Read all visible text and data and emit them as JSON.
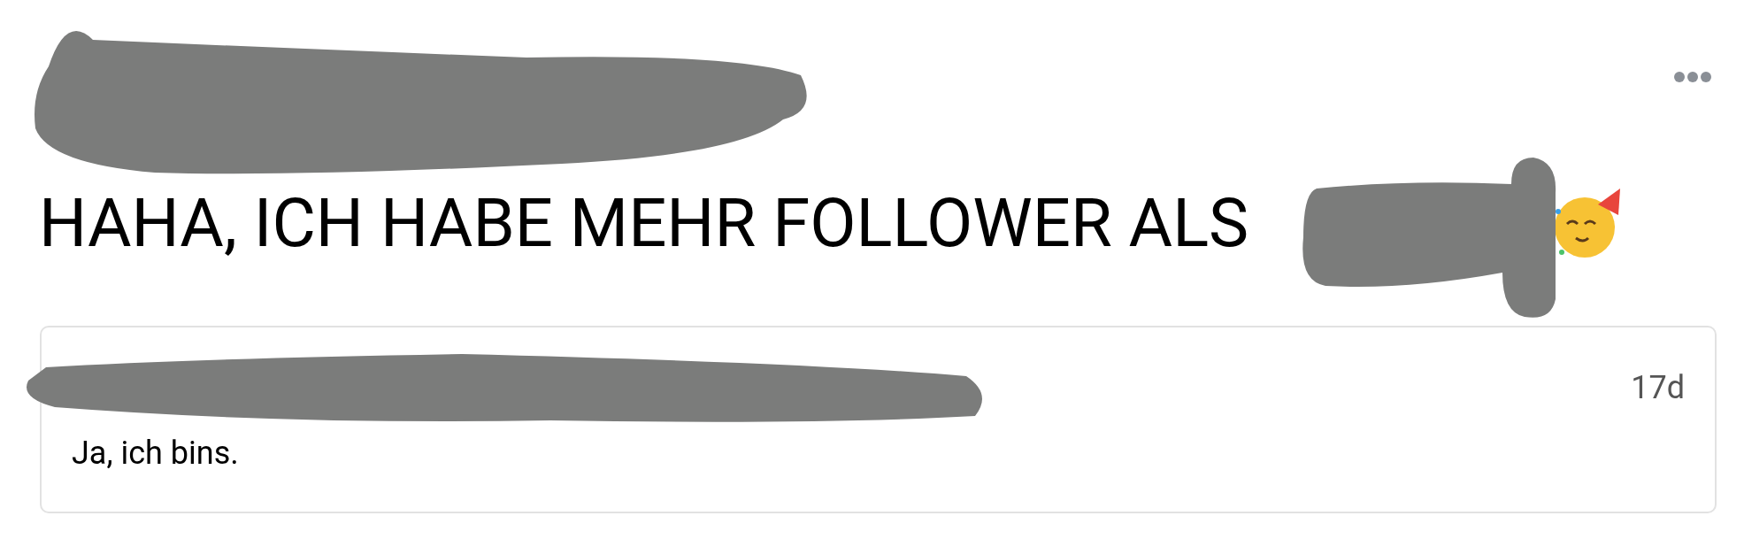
{
  "post": {
    "headline": "HAHA, ICH HABE MEHR FOLLOWER ALS"
  },
  "comment": {
    "time": "17d",
    "text": "Ja, ich bins."
  }
}
